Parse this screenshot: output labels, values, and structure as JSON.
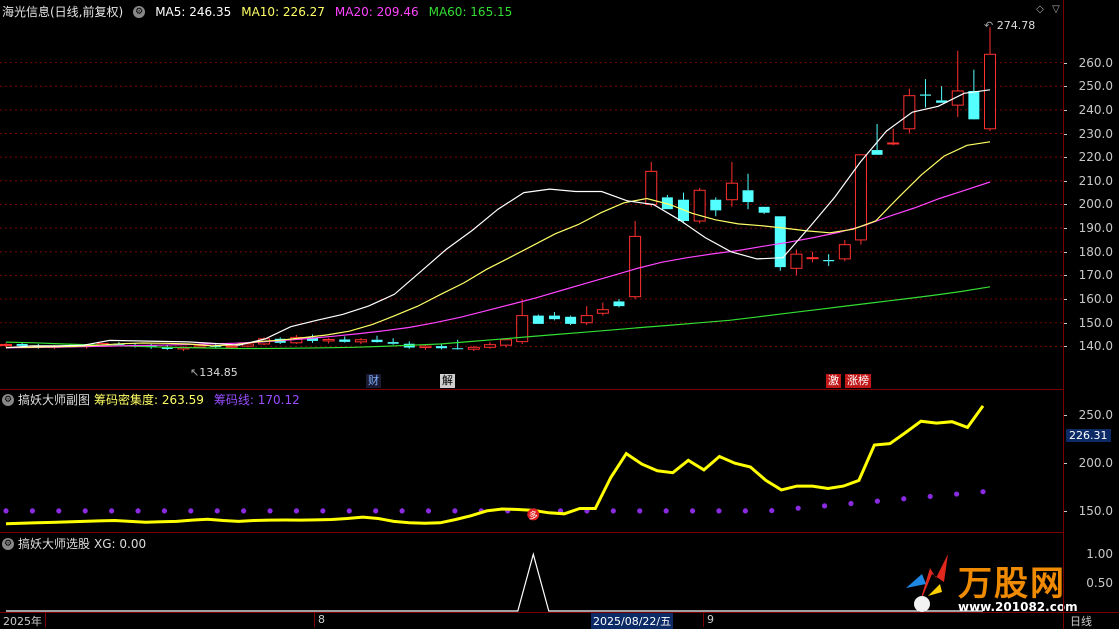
{
  "main_header": {
    "title": "海光信息(日线,前复权)",
    "ma5": "MA5: 246.35",
    "ma10": "MA10: 226.27",
    "ma20": "MA20: 209.46",
    "ma60": "MA60: 165.15"
  },
  "colors": {
    "up": "#ff3030",
    "down": "#54ffff",
    "ma5": "#ffffff",
    "ma10": "#ffff66",
    "ma20": "#ff44ff",
    "ma60": "#33dd33",
    "grid": "#7a0000",
    "density": "#ffff00",
    "chip_line": "#8a2be2"
  },
  "price_axis": [
    "260.0",
    "250.0",
    "240.0",
    "230.0",
    "220.0",
    "210.0",
    "200.0",
    "190.0",
    "180.0",
    "170.0",
    "160.0",
    "150.0",
    "140.0"
  ],
  "max_label": "274.78",
  "min_label": "134.85",
  "event_tags": {
    "cai": "财",
    "jie": "解",
    "ji": "激",
    "zhangbang": "涨榜"
  },
  "sub1_header": {
    "name": "搞妖大师副图",
    "density": "筹码密集度: 263.59",
    "chipline": "筹码线: 170.12"
  },
  "sub1_axis": [
    "250.0",
    "200.0",
    "150.0"
  ],
  "sub1_current": "226.31",
  "sub1_marker": "多",
  "sub2_header": {
    "name": "搞妖大师选股",
    "xg": "XG: 0.00"
  },
  "sub2_axis": [
    "1.00",
    "0.50"
  ],
  "time_axis": {
    "start": "2025年",
    "m8": "8",
    "cursor": "2025/08/22/五",
    "m9": "9",
    "period": "日线"
  },
  "watermark": {
    "brand": "万股网",
    "url": "www.201082.com"
  },
  "chart_data": {
    "type": "candlestick",
    "ylim": [
      130,
      278
    ],
    "candles": [
      [
        140.5,
        141.5,
        139.5,
        140.8
      ],
      [
        141,
        141.5,
        139.8,
        140.2
      ],
      [
        140.2,
        141,
        139,
        139.6
      ],
      [
        139.6,
        140.5,
        138.8,
        140.1
      ],
      [
        140.1,
        141.2,
        139.5,
        139.9
      ],
      [
        139.9,
        140.6,
        139,
        140.4
      ],
      [
        140.4,
        141.5,
        139.8,
        141.2
      ],
      [
        141.2,
        141.8,
        140.2,
        140.6
      ],
      [
        140.6,
        141.2,
        139.5,
        140.3
      ],
      [
        140.3,
        141,
        139,
        139.7
      ],
      [
        139.7,
        140.5,
        138.5,
        138.9
      ],
      [
        138.9,
        140,
        138,
        139.6
      ],
      [
        139.6,
        141,
        139.2,
        140.2
      ],
      [
        140.2,
        141,
        139.5,
        139.8
      ],
      [
        139.8,
        140.5,
        139,
        140.1
      ],
      [
        140.1,
        141.3,
        139.6,
        141
      ],
      [
        141,
        143.8,
        140.5,
        143.2
      ],
      [
        143.2,
        143.8,
        141,
        141.5
      ],
      [
        141.5,
        144.8,
        141,
        143.8
      ],
      [
        143.8,
        145,
        141.5,
        142.3
      ],
      [
        142.3,
        143.5,
        141.2,
        142.9
      ],
      [
        142.9,
        144.2,
        141.6,
        141.9
      ],
      [
        141.9,
        143.5,
        141,
        142.8
      ],
      [
        142.8,
        144.5,
        141.6,
        141.8
      ],
      [
        141.8,
        143.4,
        140.7,
        141.1
      ],
      [
        141.1,
        142.1,
        139,
        139.5
      ],
      [
        139.5,
        141,
        138.5,
        140.1
      ],
      [
        140.1,
        140.8,
        138.7,
        139.2
      ],
      [
        139.2,
        142.8,
        138.6,
        138.8
      ],
      [
        138.8,
        140.2,
        138,
        139.6
      ],
      [
        139.6,
        141.8,
        139,
        140.7
      ],
      [
        140.5,
        143.5,
        139.5,
        142.8
      ],
      [
        142,
        160,
        141,
        153
      ],
      [
        153,
        153.5,
        149.5,
        149.5
      ],
      [
        153,
        154.5,
        151,
        151.5
      ],
      [
        152.5,
        153,
        149,
        149.5
      ],
      [
        150,
        157,
        149,
        153
      ],
      [
        154,
        158.5,
        153,
        155.5
      ],
      [
        159,
        160,
        156.5,
        157
      ],
      [
        161,
        193,
        160,
        186.5
      ],
      [
        200,
        218,
        199,
        214
      ],
      [
        203,
        204,
        198,
        198
      ],
      [
        202,
        205,
        192,
        193
      ],
      [
        193,
        207,
        192,
        206
      ],
      [
        202,
        203,
        195,
        197.5
      ],
      [
        202,
        218,
        199,
        209
      ],
      [
        206,
        213,
        198,
        201
      ],
      [
        199,
        199,
        196,
        196.5
      ],
      [
        195,
        195,
        172,
        173.5
      ],
      [
        173,
        181,
        170,
        179
      ],
      [
        177.5,
        180,
        175.5,
        177.5
      ],
      [
        176.5,
        179,
        174,
        176
      ],
      [
        177,
        185,
        176,
        183
      ],
      [
        185,
        221,
        183,
        221
      ],
      [
        223,
        234,
        221,
        221
      ],
      [
        226,
        232,
        225,
        226
      ],
      [
        232,
        249,
        230,
        246
      ],
      [
        246.5,
        253,
        241,
        246
      ],
      [
        244,
        250,
        243,
        243
      ],
      [
        242,
        265,
        237,
        248
      ],
      [
        248,
        257,
        237,
        236
      ],
      [
        232,
        275,
        231,
        263.5
      ]
    ],
    "ma_series": {
      "ma5": [
        139.4,
        140.2,
        140.2,
        140.5,
        142.5,
        142.3,
        142.1,
        141.9,
        141.3,
        140.5,
        143.1,
        148.3,
        151,
        153.5,
        157,
        162,
        171.5,
        181,
        189,
        198,
        205,
        206.5,
        205.5,
        205.5,
        201.5,
        200,
        193.5,
        186,
        180,
        177,
        177.5,
        190,
        203,
        218,
        231,
        239,
        241.5,
        247,
        248.5
      ],
      "ma10": [
        139.6,
        139.6,
        139.8,
        140,
        140.5,
        141.1,
        141.4,
        141.3,
        141,
        140.2,
        140.7,
        142,
        142.6,
        143.7,
        144.8,
        146.4,
        149.2,
        153,
        157,
        162,
        166.8,
        172.6,
        177.5,
        182.5,
        187.6,
        191.5,
        196.5,
        200.7,
        202.5,
        200,
        196.2,
        193.5,
        191.8,
        191,
        190,
        188.8,
        188,
        189.5,
        193,
        203,
        212.5,
        220.5,
        225,
        226.5
      ],
      "ma20": [
        139.4,
        139.5,
        139.7,
        139.9,
        140.1,
        140.3,
        140.5,
        140.7,
        141,
        141.3,
        141.8,
        142.5,
        143.3,
        144.3,
        145.4,
        146.6,
        148,
        150,
        152.3,
        155,
        157.7,
        160.5,
        163.6,
        166.7,
        169.8,
        172.9,
        175.6,
        177.5,
        179.1,
        180.5,
        182.3,
        184,
        186,
        188.2,
        191,
        195,
        198.5,
        202.5,
        206,
        209.5
      ],
      "ma60": [
        141.8,
        141.5,
        141,
        140.6,
        140.2,
        139.8,
        139.5,
        139.3,
        139.1,
        139.1,
        139.2,
        139.4,
        139.6,
        140,
        140.5,
        141,
        142,
        143,
        144,
        145,
        146,
        147,
        148,
        149,
        150,
        151,
        152.5,
        154,
        155.5,
        157,
        158.5,
        160,
        161.5,
        163.2,
        165.2
      ]
    },
    "sub1": {
      "ylim": [
        130,
        262
      ],
      "density": [
        136.5,
        137,
        137.5,
        138,
        138.5,
        139,
        139.5,
        140,
        139,
        138.2,
        138.6,
        139,
        140.4,
        141.3,
        140,
        139,
        140,
        140.4,
        140.5,
        140.4,
        140.6,
        141,
        142,
        143.5,
        142,
        139,
        137.5,
        137,
        137.5,
        141,
        145,
        150,
        152,
        151.5,
        150.5,
        148,
        147,
        152.5,
        152.5,
        185,
        210,
        199,
        192,
        190,
        203,
        193,
        207,
        200,
        196,
        182,
        172,
        176,
        176,
        173.5,
        176,
        182,
        219,
        220.5,
        232,
        244,
        242,
        243.5,
        237.5,
        260
      ],
      "chipline": 150,
      "chipline_end": 170.12
    },
    "sub2": {
      "ylim": [
        0,
        1.2
      ],
      "xg_spike_index": 34,
      "xg_value": 1.0
    }
  }
}
